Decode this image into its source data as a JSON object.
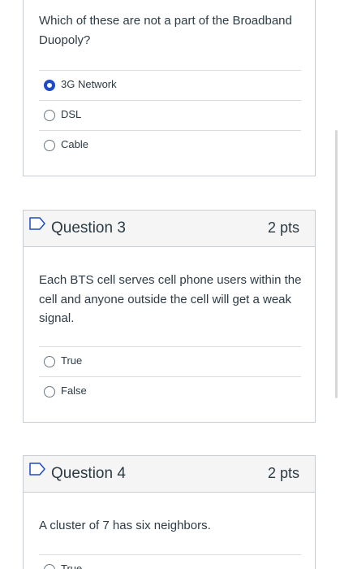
{
  "question2": {
    "text": "Which of these are not a part of the Broadband Duopoly?",
    "answers": [
      {
        "label": "3G Network",
        "selected": true
      },
      {
        "label": "DSL",
        "selected": false
      },
      {
        "label": "Cable",
        "selected": false
      }
    ]
  },
  "question3": {
    "title": "Question 3",
    "points": "2 pts",
    "text": "Each BTS cell serves cell phone users within the cell and anyone outside the cell will get a weak signal.",
    "answers": [
      {
        "label": "True",
        "selected": false
      },
      {
        "label": "False",
        "selected": false
      }
    ]
  },
  "question4": {
    "title": "Question 4",
    "points": "2 pts",
    "text": "A cluster of 7 has six neighbors.",
    "answers": [
      {
        "label": "True",
        "selected": false
      }
    ]
  },
  "colors": {
    "accent": "#1d4bc8",
    "border": "#c7cdd1",
    "header_bg": "#f5f5f5",
    "text": "#2d3b45"
  },
  "icons": {
    "bookmark": "bookmark-icon"
  }
}
